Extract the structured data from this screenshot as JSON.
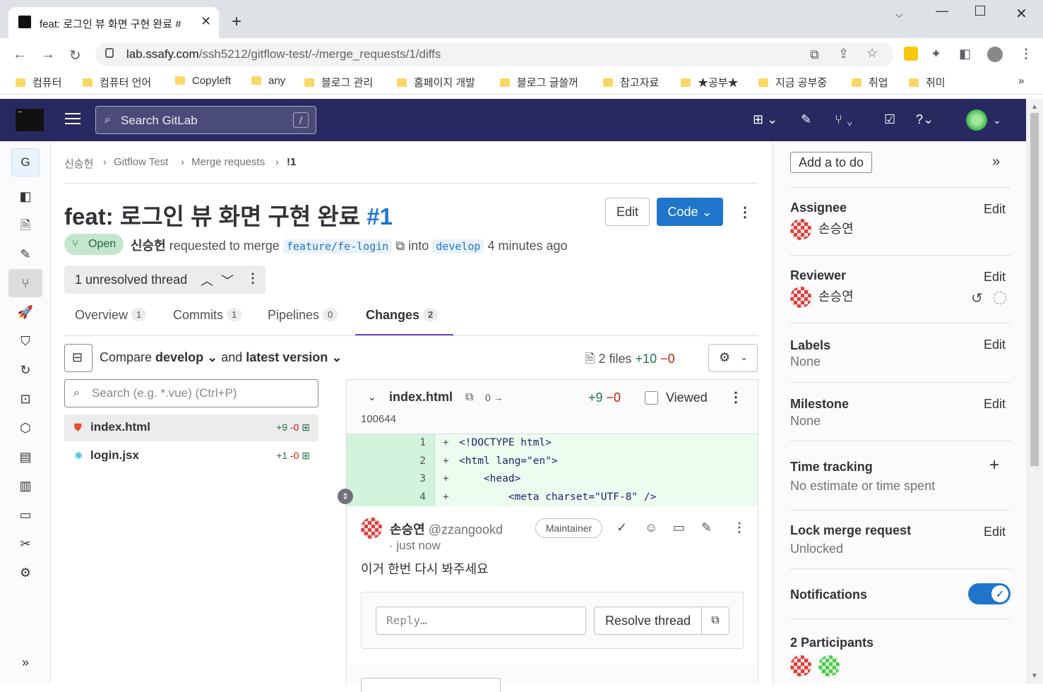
{
  "browser": {
    "tab_title": "feat: 로그인 뷰 화면 구현 완료 #",
    "tab_close": "✕",
    "new_tab": "+",
    "url_domain": "lab.ssafy.com",
    "url_path": "/ssh5212/gitflow-test/-/merge_requests/1/diffs",
    "bookmarks": [
      "컴퓨터",
      "컴퓨터 언어",
      "Copyleft",
      "any",
      "블로그 관리",
      "홈페이지 개발",
      "블로그 글쓸꺼",
      "참고자료",
      "★공부★",
      "지금 공부중",
      "취업",
      "취미"
    ],
    "bookmarks_more": "»"
  },
  "gitlab_header": {
    "search_placeholder": "Search GitLab",
    "search_shortcut": "/"
  },
  "sidebar": {
    "project_initial": "G",
    "collapse": "»"
  },
  "breadcrumb": [
    "신승헌",
    "Gitflow Test",
    "Merge requests",
    "!1"
  ],
  "mr": {
    "title": "feat: 로그인 뷰 화면 구현 완료",
    "iid": "#1",
    "edit_label": "Edit",
    "code_label": "Code",
    "status": "Open",
    "author": "신승헌",
    "requested_text": "requested to merge",
    "source_branch": "feature/fe-login",
    "into_text": "into",
    "target_branch": "develop",
    "time_ago": "4 minutes ago",
    "unresolved": "1 unresolved thread"
  },
  "tabs": [
    {
      "label": "Overview",
      "count": "1"
    },
    {
      "label": "Commits",
      "count": "1"
    },
    {
      "label": "Pipelines",
      "count": "0"
    },
    {
      "label": "Changes",
      "count": "2"
    }
  ],
  "compare": {
    "prefix": "Compare",
    "base": "develop",
    "and": "and",
    "head": "latest version",
    "files": "2 files",
    "additions": "+10",
    "deletions": "−0"
  },
  "file_search_placeholder": "Search (e.g. *.vue) (Ctrl+P)",
  "files": [
    {
      "name": "index.html",
      "add": "+9",
      "del": "-0"
    },
    {
      "name": "login.jsx",
      "add": "+1",
      "del": "-0"
    }
  ],
  "diff": {
    "file": "index.html",
    "mode_change": "0 →",
    "additions": "+9",
    "deletions": "−0",
    "viewed_label": "Viewed",
    "permissions": "100644",
    "lines": [
      {
        "num": "1",
        "sign": "+",
        "code": "<!DOCTYPE html>"
      },
      {
        "num": "2",
        "sign": "+",
        "code": "<html lang=\"en\">"
      },
      {
        "num": "3",
        "sign": "+",
        "code": "    <head>"
      },
      {
        "num": "4",
        "sign": "+",
        "code": "        <meta charset=\"UTF-8\" />"
      }
    ]
  },
  "comment": {
    "author": "손승연",
    "username": "@zzangookd",
    "time": "· just now",
    "role": "Maintainer",
    "body": "이거 한번 다시 봐주세요",
    "reply_placeholder": "Reply…",
    "resolve_label": "Resolve thread"
  },
  "right_sidebar": {
    "todo": "Add a to do",
    "assignee_title": "Assignee",
    "assignee": "손승연",
    "reviewer_title": "Reviewer",
    "reviewer": "손승연",
    "labels_title": "Labels",
    "labels_value": "None",
    "milestone_title": "Milestone",
    "milestone_value": "None",
    "time_title": "Time tracking",
    "time_value": "No estimate or time spent",
    "lock_title": "Lock merge request",
    "lock_value": "Unlocked",
    "notifications_title": "Notifications",
    "notifications_on": true,
    "participants_title": "2 Participants",
    "edit_label": "Edit"
  },
  "colors": {
    "header_bg": "#292961",
    "primary": "#1f75cb",
    "open_badge_bg": "#c3e6cd",
    "diff_added_bg": "#ecfdf0",
    "tab_active": "#6e49cb"
  }
}
